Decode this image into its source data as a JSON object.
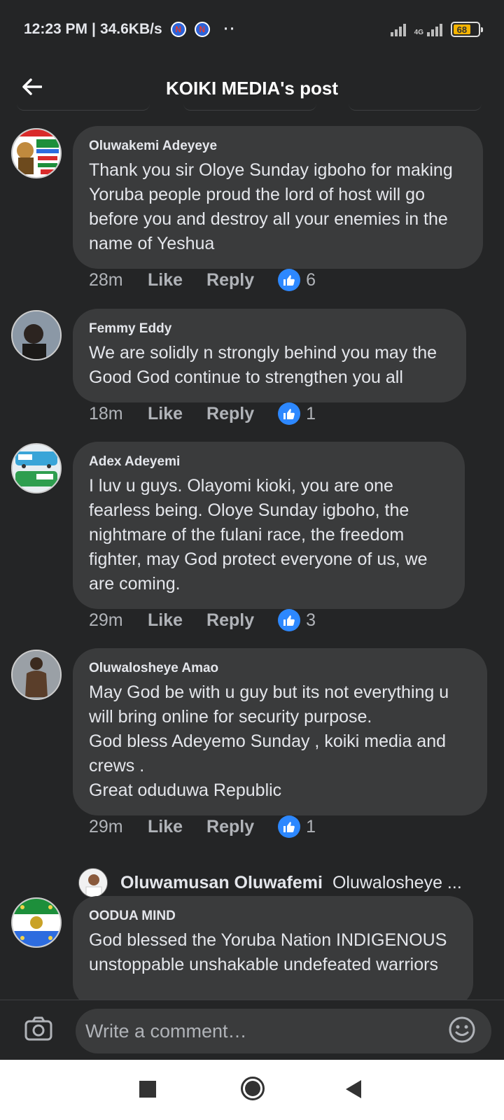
{
  "status_bar": {
    "time": "12:23 PM",
    "speed": "34.6KB/s",
    "notif_glyph": "N",
    "more": "··",
    "network": "4G",
    "battery": "68"
  },
  "header": {
    "title": "KOIKI MEDIA's post",
    "back_icon": "arrow-left-icon"
  },
  "comments": [
    {
      "author": "Oluwakemi Adeyeye",
      "text": "Thank you sir Oloye Sunday igboho for making Yoruba people proud the lord of host will go before you and destroy all your enemies in the name of Yeshua",
      "time": "28m",
      "like_label": "Like",
      "reply_label": "Reply",
      "reactions": "6",
      "avatar_text": "YORUBA 2023",
      "avatar_colors": [
        "#ffffff",
        "#1d8f3b",
        "#d92b2b"
      ]
    },
    {
      "author": "Femmy Eddy",
      "text": "We are solidly n strongly behind you may the Good God continue to strengthen you all",
      "time": "18m",
      "like_label": "Like",
      "reply_label": "Reply",
      "reactions": "1",
      "avatar_colors": [
        "#8b98a6",
        "#2c2420"
      ]
    },
    {
      "author": "Adex Adeyemi",
      "text": "I luv u guys. Olayomi kioki, you are one fearless being. Oloye Sunday igboho, the nightmare of the fulani race, the freedom fighter, may God protect everyone of us, we are coming.",
      "time": "29m",
      "like_label": "Like",
      "reply_label": "Reply",
      "reactions": "3",
      "avatar_colors": [
        "#3aa5d8",
        "#2e9e4f",
        "#ffffff"
      ]
    },
    {
      "author": "Oluwalosheye Amao",
      "text": "May God be with u guy but its not everything u will bring online for security purpose.\nGod bless Adeyemo Sunday , koiki media and crews .\nGreat oduduwa Republic",
      "time": "29m",
      "like_label": "Like",
      "reply_label": "Reply",
      "reactions": "1",
      "avatar_colors": [
        "#9aa0a6",
        "#5a3e2a"
      ]
    },
    {
      "author": "OODUA MIND",
      "text": "God blessed the Yoruba Nation INDIGENOUS unstoppable unshakable undefeated warriors",
      "avatar_colors": [
        "#1d8f3b",
        "#ffffff",
        "#2d6cdf"
      ]
    }
  ],
  "reply_preview": {
    "name": "Oluwamusan Oluwafemi",
    "text": "Oluwalosheye ..."
  },
  "composer": {
    "placeholder": "Write a comment…",
    "camera_icon": "camera-icon",
    "emoji_icon": "emoji-icon"
  },
  "navbar": {
    "recents_icon": "square-icon",
    "home_icon": "circle-icon",
    "back_icon": "triangle-back-icon"
  },
  "colors": {
    "background": "#242526",
    "bubble": "#3a3b3c",
    "like_blue": "#2d88ff",
    "text": "#e4e6eb",
    "muted": "#b0b3b8"
  }
}
